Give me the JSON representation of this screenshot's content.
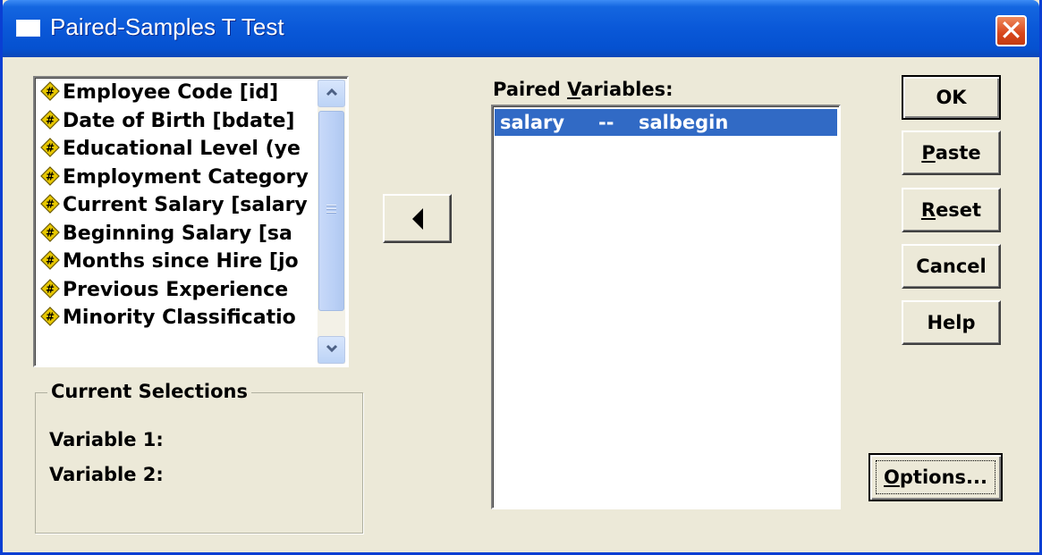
{
  "window": {
    "title": "Paired-Samples T Test",
    "close_glyph": "✕"
  },
  "variables": [
    {
      "label": "Employee Code [id]",
      "icon": "numeric-scale-icon"
    },
    {
      "label": "Date of Birth [bdate]",
      "icon": "numeric-scale-icon"
    },
    {
      "label": "Educational Level (ye",
      "icon": "numeric-scale-icon"
    },
    {
      "label": "Employment Category",
      "icon": "numeric-scale-icon"
    },
    {
      "label": "Current Salary [salary",
      "icon": "numeric-scale-icon"
    },
    {
      "label": "Beginning Salary [sa",
      "icon": "numeric-scale-icon"
    },
    {
      "label": "Months since Hire [jo",
      "icon": "numeric-scale-icon"
    },
    {
      "label": "Previous Experience",
      "icon": "numeric-scale-icon"
    },
    {
      "label": "Minority Classificatio",
      "icon": "numeric-scale-icon"
    }
  ],
  "current_selections": {
    "title": "Current Selections",
    "variable1_label": "Variable 1:",
    "variable2_label": "Variable 2:"
  },
  "move_button": {
    "icon": "left-arrow-icon"
  },
  "paired": {
    "label_pre": "Paired ",
    "label_mnemonic": "V",
    "label_post": "ariables:",
    "rows": [
      {
        "var1": "salary",
        "separator": "--",
        "var2": "salbegin"
      }
    ]
  },
  "buttons": {
    "ok": "OK",
    "paste_mnemonic": "P",
    "paste_rest": "aste",
    "reset_mnemonic": "R",
    "reset_rest": "eset",
    "cancel": "Cancel",
    "help": "Help",
    "options_mnemonic": "O",
    "options_rest": "ptions..."
  },
  "colors": {
    "titlebar": "#0a58d8",
    "selection": "#316ac5",
    "dialog_bg": "#ece9d8",
    "variable_icon": "#e8c800"
  }
}
